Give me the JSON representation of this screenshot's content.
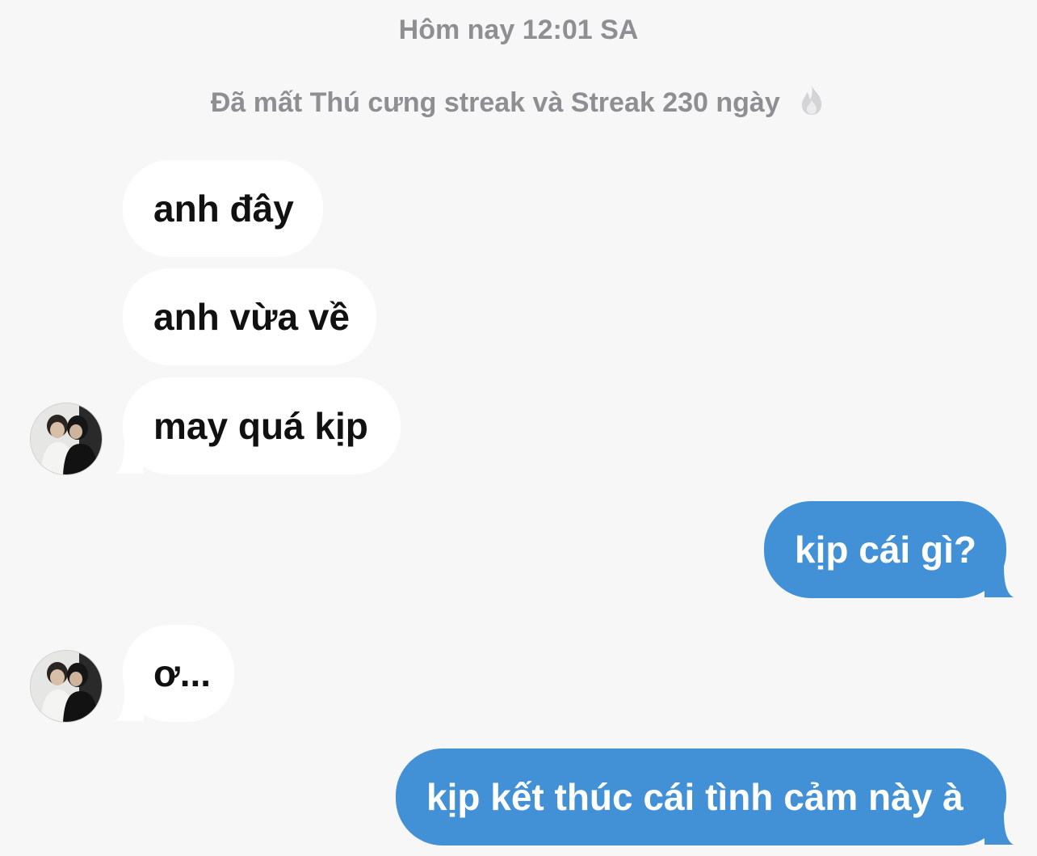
{
  "chat": {
    "timestamp": "Hôm nay 12:01 SA",
    "streak_notice": "Đã mất Thú cưng streak và Streak 230 ngày",
    "streak_icon": "fire-icon",
    "colors": {
      "background": "#f7f7f8",
      "incoming_bubble": "#ffffff",
      "outgoing_bubble": "#4291d6",
      "meta_text": "#8e8e93"
    },
    "messages": [
      {
        "direction": "incoming",
        "text": "anh đây"
      },
      {
        "direction": "incoming",
        "text": "anh vừa về"
      },
      {
        "direction": "incoming",
        "text": "may quá kịp"
      },
      {
        "direction": "outgoing",
        "text": "kịp cái gì?"
      },
      {
        "direction": "incoming",
        "text": "ơ..."
      },
      {
        "direction": "outgoing",
        "text": "kịp kết thúc cái tình cảm này à"
      }
    ]
  }
}
